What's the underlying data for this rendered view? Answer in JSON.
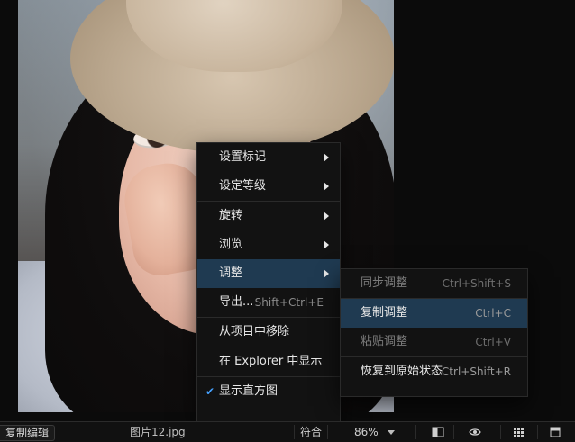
{
  "toolbar": {
    "copy_edit": "复制编辑",
    "filename": "图片12.jpg",
    "fit": "符合",
    "zoom": "86%"
  },
  "context_menu": {
    "items": [
      {
        "label": "设置标记",
        "shortcut": "",
        "has_submenu": true,
        "checked": false,
        "active": false
      },
      {
        "label": "设定等级",
        "shortcut": "",
        "has_submenu": true,
        "checked": false,
        "active": false
      },
      {
        "label": "旋转",
        "shortcut": "",
        "has_submenu": true,
        "checked": false,
        "active": false
      },
      {
        "label": "浏览",
        "shortcut": "",
        "has_submenu": true,
        "checked": false,
        "active": false
      },
      {
        "label": "调整",
        "shortcut": "",
        "has_submenu": true,
        "checked": false,
        "active": true
      },
      {
        "label": "导出...",
        "shortcut": "Shift+Ctrl+E",
        "has_submenu": false,
        "checked": false,
        "active": false
      },
      {
        "label": "从项目中移除",
        "shortcut": "",
        "has_submenu": false,
        "checked": false,
        "active": false
      },
      {
        "label": "在 Explorer 中显示",
        "shortcut": "",
        "has_submenu": false,
        "checked": false,
        "active": false
      },
      {
        "label": "显示直方图",
        "shortcut": "",
        "has_submenu": false,
        "checked": true,
        "active": false
      }
    ]
  },
  "submenu_adjust": {
    "items": [
      {
        "label": "同步调整",
        "shortcut": "Ctrl+Shift+S",
        "enabled": false,
        "active": false
      },
      {
        "label": "复制调整",
        "shortcut": "Ctrl+C",
        "enabled": true,
        "active": true
      },
      {
        "label": "粘贴调整",
        "shortcut": "Ctrl+V",
        "enabled": false,
        "active": false
      },
      {
        "label": "恢复到原始状态",
        "shortcut": "Ctrl+Shift+R",
        "enabled": true,
        "active": false
      }
    ]
  },
  "icons": {
    "compare": "compare-icon",
    "eye": "eye-icon",
    "grid": "grid-icon",
    "panel": "panel-icon",
    "check": "checkmark-icon",
    "submenu_arrow": "chevron-right-icon",
    "zoom_caret": "chevron-down-icon"
  },
  "colors": {
    "menu_active_bg": "#1f3a51",
    "check": "#45a1ff"
  }
}
